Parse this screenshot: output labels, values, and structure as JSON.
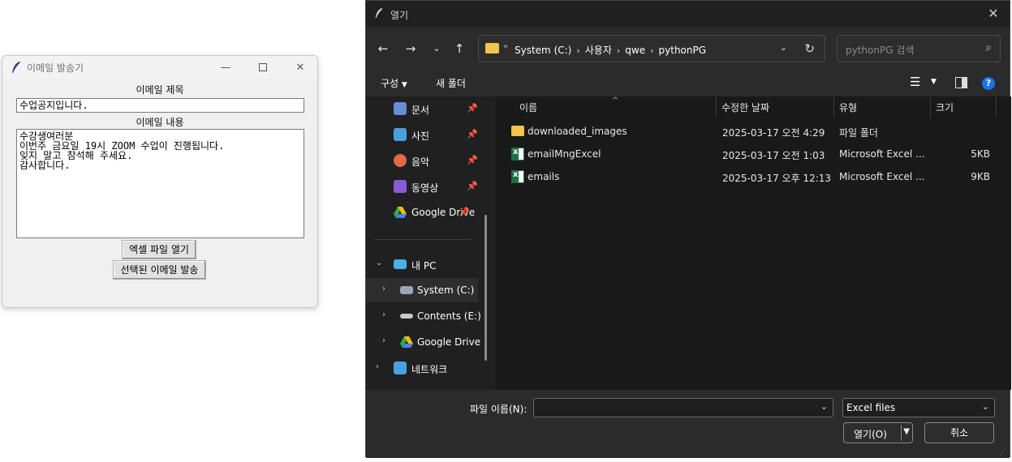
{
  "email_window": {
    "title": "이메일 발송기",
    "subject_label": "이메일 제목",
    "subject_value": "수업공지입니다.",
    "body_label": "이메일 내용",
    "body_lines": [
      "수강생여러분",
      "이번주 금요일 19시 ZOOM 수업이 진행됩니다.",
      "잊지 말고 참석해 주세요.",
      "감사합니다."
    ],
    "open_excel_button": "엑셀 파일 열기",
    "send_button": "선택된 이메일 발송"
  },
  "file_dialog": {
    "title": "열기",
    "address": [
      "System (C:)",
      "사용자",
      "qwe",
      "pythonPG"
    ],
    "search_placeholder": "pythonPG 검색",
    "toolbar": {
      "organize": "구성",
      "new_folder": "새 폴더"
    },
    "nav": {
      "quick": [
        {
          "label": "문서",
          "icon": "document-icon",
          "color": "#6a8bd6"
        },
        {
          "label": "사진",
          "icon": "pictures-icon",
          "color": "#4a9fe0"
        },
        {
          "label": "음악",
          "icon": "music-icon",
          "color": "#e06a4a"
        },
        {
          "label": "동영상",
          "icon": "video-icon",
          "color": "#8a5ad6"
        },
        {
          "label": "Google Drive",
          "icon": "google-drive-icon",
          "color": "#34a853"
        }
      ],
      "this_pc": "내 PC",
      "drives": [
        {
          "label": "System (C:)",
          "icon": "system-drive-icon"
        },
        {
          "label": "Contents (E:)",
          "icon": "drive-icon"
        },
        {
          "label": "Google Drive (",
          "icon": "google-drive-icon"
        }
      ],
      "network": "네트워크"
    },
    "columns": {
      "name": "이름",
      "modified": "수정한 날짜",
      "type": "유형",
      "size": "크기"
    },
    "files": [
      {
        "name": "downloaded_images",
        "modified": "2025-03-17 오전 4:29",
        "type": "파일 폴더",
        "size": "",
        "kind": "folder"
      },
      {
        "name": "emailMngExcel",
        "modified": "2025-03-17 오전 1:03",
        "type": "Microsoft Excel ...",
        "size": "5KB",
        "kind": "excel"
      },
      {
        "name": "emails",
        "modified": "2025-03-17 오후 12:13",
        "type": "Microsoft Excel ...",
        "size": "9KB",
        "kind": "excel"
      }
    ],
    "filename_label": "파일 이름(N):",
    "filename_value": "",
    "file_type": "Excel files",
    "open_button": "열기(O)",
    "cancel_button": "취소"
  }
}
